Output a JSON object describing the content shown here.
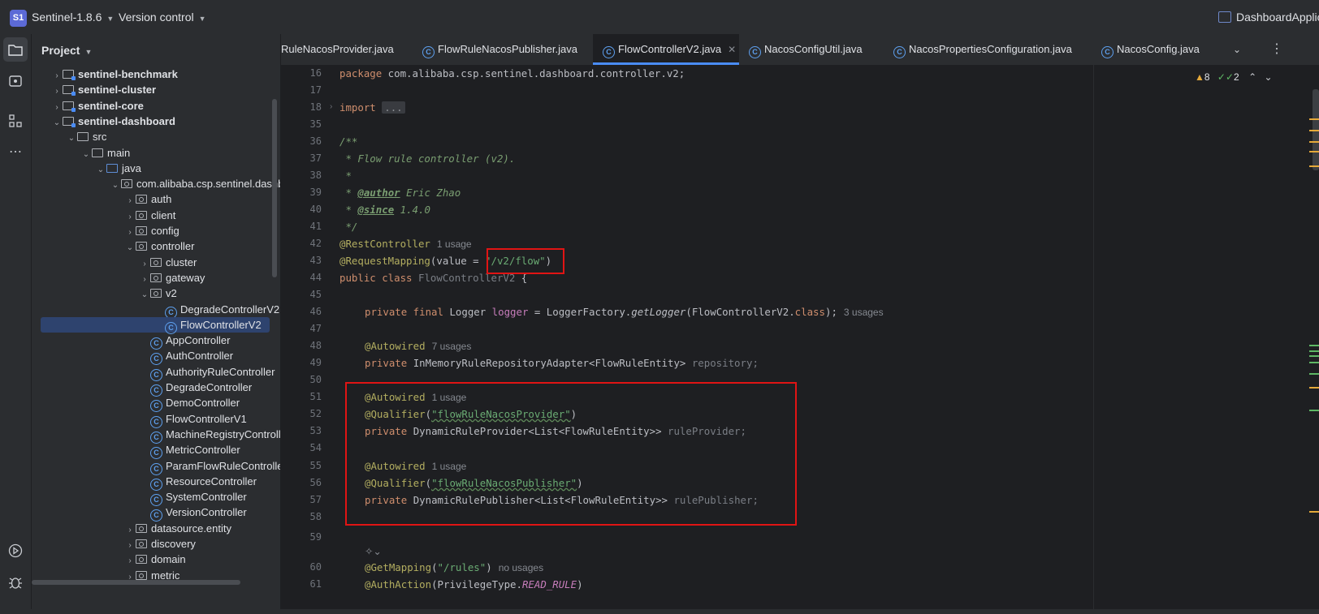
{
  "titlebar": {
    "project_badge": "S1",
    "project_name": "Sentinel-1.8.6",
    "vcs_label": "Version control",
    "run_config": "DashboardApplic"
  },
  "project_panel": {
    "title": "Project",
    "tree": [
      {
        "label": "sentinel-benchmark",
        "kind": "module",
        "bold": true
      },
      {
        "label": "sentinel-cluster",
        "kind": "module",
        "bold": true
      },
      {
        "label": "sentinel-core",
        "kind": "module",
        "bold": true
      },
      {
        "label": "sentinel-dashboard",
        "kind": "module",
        "bold": true
      },
      {
        "label": "src",
        "kind": "folder"
      },
      {
        "label": "main",
        "kind": "folder"
      },
      {
        "label": "java",
        "kind": "folder"
      },
      {
        "label": "com.alibaba.csp.sentinel.dashbo",
        "kind": "package"
      },
      {
        "label": "auth",
        "kind": "package"
      },
      {
        "label": "client",
        "kind": "package"
      },
      {
        "label": "config",
        "kind": "package"
      },
      {
        "label": "controller",
        "kind": "package"
      },
      {
        "label": "cluster",
        "kind": "package"
      },
      {
        "label": "gateway",
        "kind": "package"
      },
      {
        "label": "v2",
        "kind": "package"
      },
      {
        "label": "DegradeControllerV2",
        "kind": "class"
      },
      {
        "label": "FlowControllerV2",
        "kind": "class",
        "selected": true
      },
      {
        "label": "AppController",
        "kind": "class"
      },
      {
        "label": "AuthController",
        "kind": "class"
      },
      {
        "label": "AuthorityRuleController",
        "kind": "class"
      },
      {
        "label": "DegradeController",
        "kind": "class"
      },
      {
        "label": "DemoController",
        "kind": "class"
      },
      {
        "label": "FlowControllerV1",
        "kind": "class"
      },
      {
        "label": "MachineRegistryController",
        "kind": "class"
      },
      {
        "label": "MetricController",
        "kind": "class"
      },
      {
        "label": "ParamFlowRuleController",
        "kind": "class"
      },
      {
        "label": "ResourceController",
        "kind": "class"
      },
      {
        "label": "SystemController",
        "kind": "class"
      },
      {
        "label": "VersionController",
        "kind": "class"
      },
      {
        "label": "datasource.entity",
        "kind": "package"
      },
      {
        "label": "discovery",
        "kind": "package"
      },
      {
        "label": "domain",
        "kind": "package"
      },
      {
        "label": "metric",
        "kind": "package"
      }
    ]
  },
  "tabs": [
    {
      "label": "RuleNacosProvider.java"
    },
    {
      "label": "FlowRuleNacosPublisher.java"
    },
    {
      "label": "FlowControllerV2.java",
      "active": true
    },
    {
      "label": "NacosConfigUtil.java"
    },
    {
      "label": "NacosPropertiesConfiguration.java"
    },
    {
      "label": "NacosConfig.java"
    }
  ],
  "inspection": {
    "warnings": "8",
    "weak_warnings": "2"
  },
  "editor": {
    "line_numbers": [
      "16",
      "17",
      "18",
      "35",
      "36",
      "37",
      "38",
      "39",
      "40",
      "41",
      "42",
      "43",
      "44",
      "45",
      "46",
      "47",
      "48",
      "49",
      "50",
      "51",
      "52",
      "53",
      "54",
      "55",
      "56",
      "57",
      "58",
      "59",
      "",
      "60",
      "61"
    ],
    "package_kw": "package",
    "package_name": " com.alibaba.csp.sentinel.dashboard.controller.v2;",
    "import_kw": "import",
    "import_fold": "...",
    "doc_open": "/**",
    "doc_desc": " * Flow rule controller (v2).",
    "doc_star": " *",
    "doc_author_prefix": " * ",
    "doc_author_tag": "@author",
    "doc_author_val": " Eric Zhao",
    "doc_since_prefix": " * ",
    "doc_since_tag": "@since",
    "doc_since_val": " 1.4.0",
    "doc_close": " */",
    "rest_controller": "@RestController",
    "rest_controller_hint": "1 usage",
    "req_mapping": "@RequestMapping",
    "req_mapping_args": "(value = ",
    "req_mapping_value": "\"/v2/flow\"",
    "req_mapping_close": ")",
    "class_decl_kw": "public class ",
    "class_name": "FlowControllerV2",
    "class_open": " {",
    "logger_kw": "private final ",
    "logger_type": "Logger ",
    "logger_name": "logger",
    "logger_init": " = LoggerFactory.",
    "logger_method": "getLogger",
    "logger_args": "(FlowControllerV2.",
    "logger_class_kw": "class",
    "logger_end": ");",
    "logger_hint": "3 usages",
    "autowired": "@Autowired",
    "repo_hint": "7 usages",
    "repo_kw": "private ",
    "repo_type": "InMemoryRuleRepositoryAdapter<FlowRuleEntity> ",
    "repo_name": "repository;",
    "provider_hint": "1 usage",
    "qualifier": "@Qualifier",
    "provider_q_val": "\"flowRuleNacosProvider\"",
    "provider_kw": "private ",
    "provider_type": "DynamicRuleProvider<List<FlowRuleEntity>> ",
    "provider_name": "ruleProvider;",
    "publisher_hint": "1 usage",
    "publisher_q_val": "\"flowRuleNacosPublisher\"",
    "publisher_kw": "private ",
    "publisher_type": "DynamicRulePublisher<List<FlowRuleEntity>> ",
    "publisher_name": "rulePublisher;",
    "ai_glyph": "✧⌄",
    "get_mapping": "@GetMapping",
    "get_mapping_val": "\"/rules\"",
    "get_mapping_hint": "no usages",
    "auth_action": "@AuthAction",
    "auth_action_args": "(PrivilegeType.",
    "auth_action_val": "READ_RULE",
    "auth_action_close": ")"
  },
  "colors": {
    "accent": "#4a8cf6",
    "highlight_box": "#e01414",
    "warning": "#e5a93a",
    "ok": "#5fb865"
  }
}
